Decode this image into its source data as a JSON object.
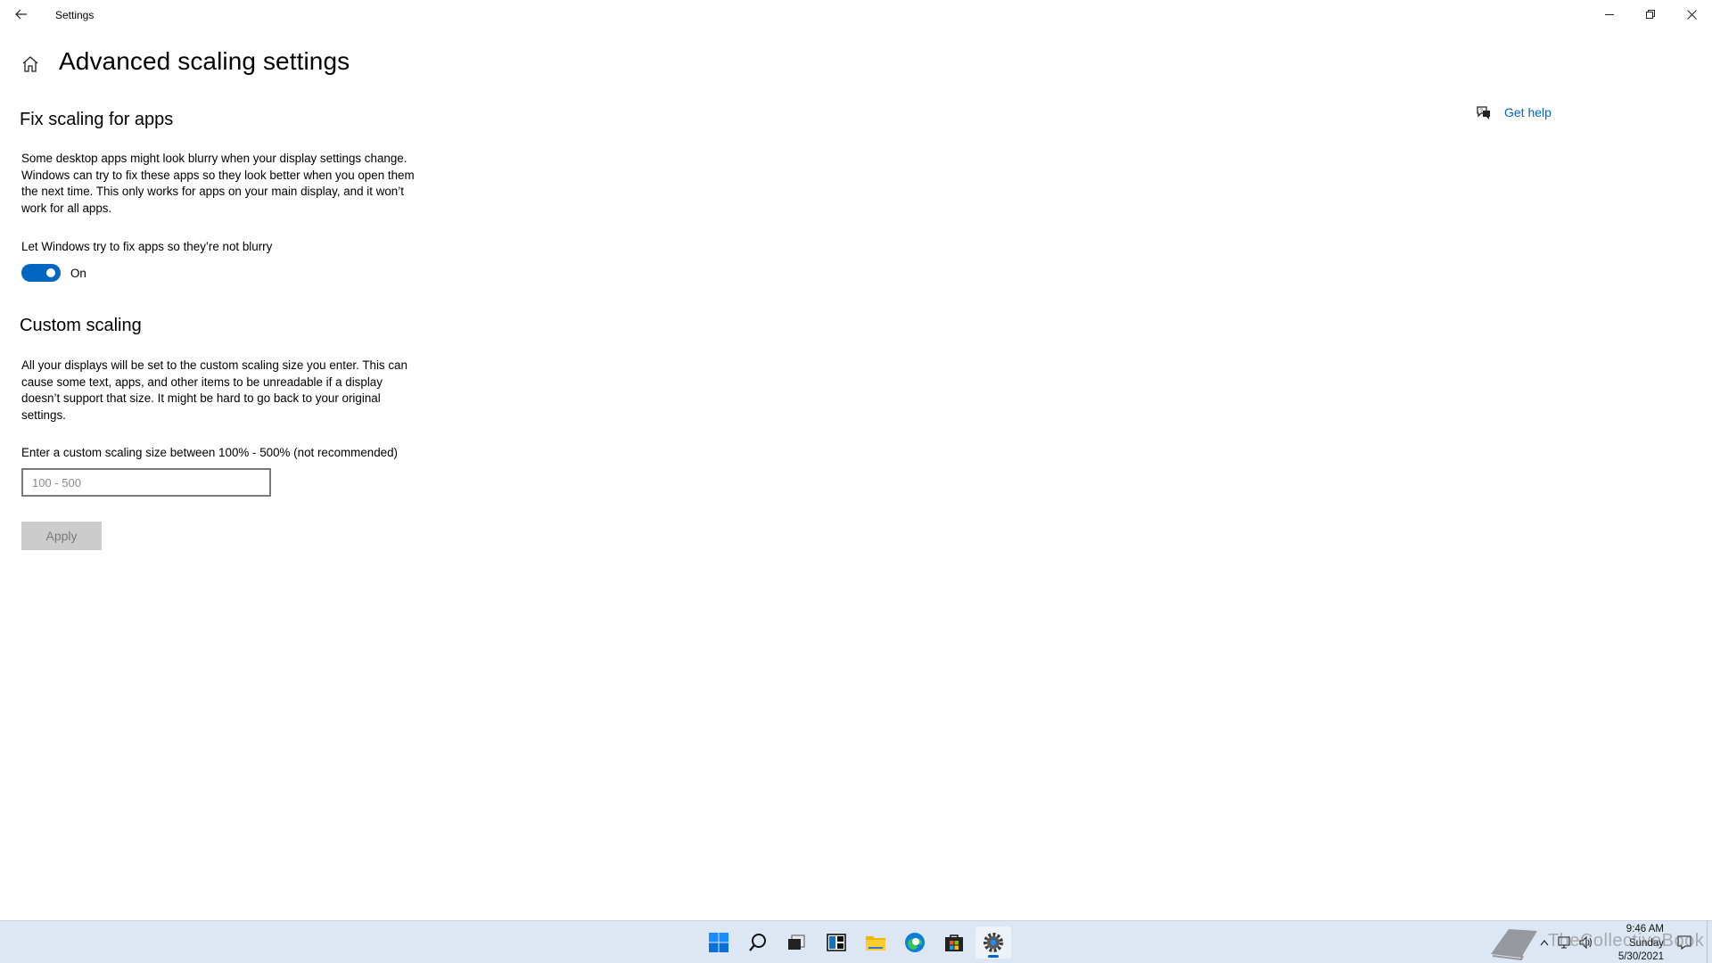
{
  "window": {
    "title": "Settings"
  },
  "header": {
    "page_title": "Advanced scaling settings"
  },
  "fix_scaling": {
    "heading": "Fix scaling for apps",
    "description": "Some desktop apps might look blurry when your display settings change. Windows can try to fix these apps so they look better when you open them the next time. This only works for apps on your main display, and it won’t work for all apps.",
    "toggle_label": "Let Windows try to fix apps so they’re not blurry",
    "toggle_state": "On",
    "toggle_on": true
  },
  "custom_scaling": {
    "heading": "Custom scaling",
    "description": "All your displays will be set to the custom scaling size you enter. This can cause some text, apps, and other items to be unreadable if a display doesn’t support that size. It might be hard to go back to your original settings.",
    "input_label": "Enter a custom scaling size between 100% - 500% (not recommended)",
    "input_placeholder": "100 - 500",
    "input_value": "",
    "apply_label": "Apply"
  },
  "help": {
    "link_label": "Get help",
    "icon": "chat-help-icon"
  },
  "taskbar": {
    "icons": [
      "start-icon",
      "search-icon",
      "task-view-icon",
      "widgets-icon",
      "file-explorer-icon",
      "edge-icon",
      "store-icon",
      "settings-icon"
    ],
    "active_app": "settings-icon",
    "clock_time": "9:46 AM",
    "clock_day": "Sunday",
    "clock_date": "5/30/2021",
    "watermark": "TheCollectiveBook"
  },
  "colors": {
    "accent": "#0067c0",
    "taskbar_bg": "#dde7f3",
    "disabled_button": "#cccccc"
  }
}
